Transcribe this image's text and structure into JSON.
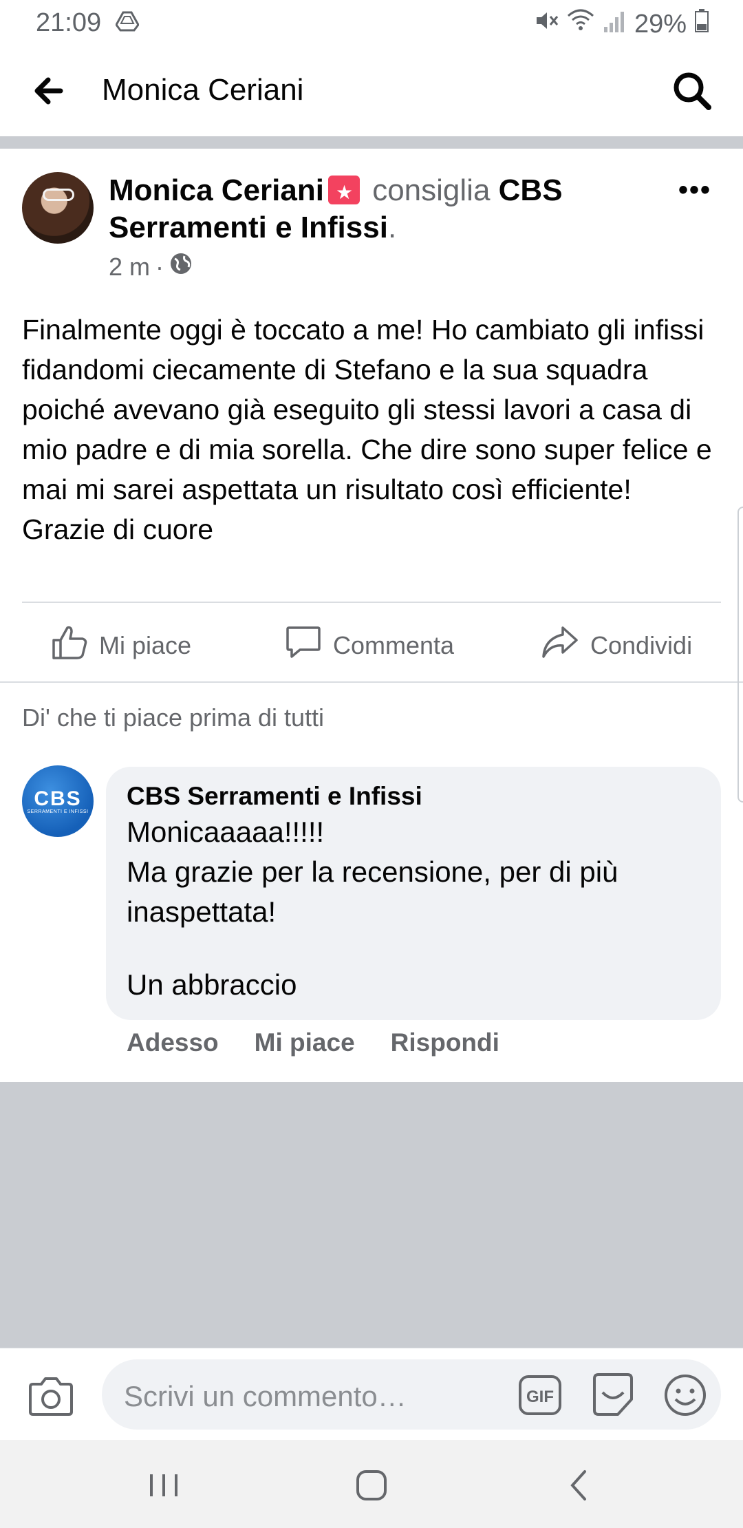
{
  "status_bar": {
    "time": "21:09",
    "battery": "29%"
  },
  "app_bar": {
    "title": "Monica Ceriani"
  },
  "post": {
    "author": "Monica Ceriani",
    "verb": "consiglia",
    "page": "CBS Serramenti e Infissi",
    "time": "2 m",
    "text": "Finalmente oggi è toccato a me! Ho cambiato gli infissi fidandomi ciecamente di Stefano e la sua squadra poiché avevano già eseguito gli stessi lavori a casa di mio padre e di mia sorella. Che dire sono super felice e mai mi sarei aspettata un risultato così efficiente! Grazie di cuore"
  },
  "actions": {
    "like": "Mi piace",
    "comment": "Commenta",
    "share": "Condividi"
  },
  "first_like_prompt": "Di' che ti piace prima di tutti",
  "comment": {
    "author": "CBS Serramenti e Infissi",
    "avatar_text": "CBS",
    "avatar_subtext": "SERRAMENTI E INFISSI",
    "lines": [
      "Monicaaaaa!!!!!",
      "Ma grazie per la recensione, per di più",
      "inaspettata!",
      "Un abbraccio"
    ],
    "time": "Adesso",
    "like": "Mi piace",
    "reply": "Rispondi"
  },
  "composer": {
    "placeholder": "Scrivi un commento…"
  },
  "colors": {
    "icon": "#65676b",
    "divider": "#c9ccd1",
    "bubble": "#f0f2f5",
    "badge": "#f3425f",
    "page_avatar": "#1560b8"
  }
}
